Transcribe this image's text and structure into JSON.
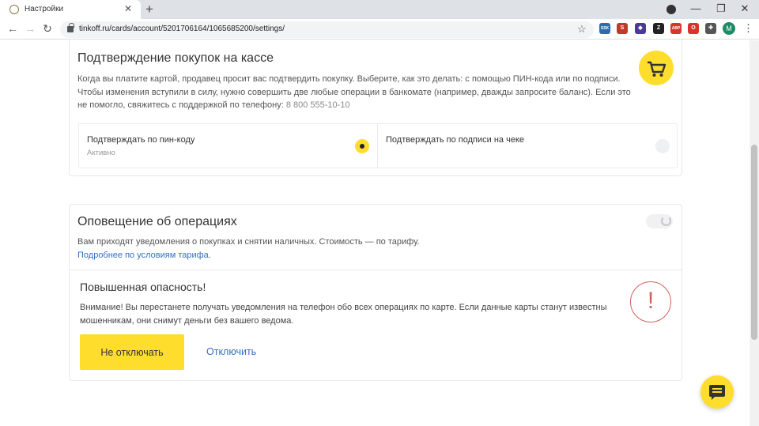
{
  "browser": {
    "tab_title": "Настройки",
    "tab_close": "✕",
    "new_tab": "+",
    "url": "tinkoff.ru/cards/account/5201706164/1065685200/settings/",
    "avatar_letter": "M",
    "window_controls": [
      "—",
      "❐",
      "✕"
    ],
    "extensions": [
      {
        "name": "ssk-extension",
        "label": "SSK",
        "color": "#2b6cb0"
      },
      {
        "name": "red-s-extension",
        "label": "S",
        "color": "#c0392b"
      },
      {
        "name": "purple-extension",
        "label": "◆",
        "color": "#4b3a9b"
      },
      {
        "name": "z-extension",
        "label": "Z",
        "color": "#222222"
      },
      {
        "name": "abp-extension",
        "label": "ABP",
        "color": "#d9342b"
      },
      {
        "name": "opera-extension",
        "label": "O",
        "color": "#d9342b"
      },
      {
        "name": "puzzle-extension",
        "label": "✚",
        "color": "#555555"
      }
    ]
  },
  "purchase_confirm": {
    "title": "Подтверждение покупок на кассе",
    "description_lines": [
      "Когда вы платите картой, продавец просит вас подтвердить покупку. Выберите, как это делать: с помощью ПИН-кода или по подписи.",
      "Чтобы изменения вступили в силу, нужно совершить две любые операции в банкомате (например, дважды запросите баланс). Если это",
      "не помогло, свяжитесь с поддержкой по телефону:"
    ],
    "phone": "8 800 555-10-10",
    "options": [
      {
        "label": "Подтверждать по пин-коду",
        "status": "Активно",
        "selected": true
      },
      {
        "label": "Подтверждать по подписи на чеке",
        "status": "",
        "selected": false
      }
    ]
  },
  "notifications": {
    "title": "Оповещение об операциях",
    "description": "Вам приходят уведомления о покупках и снятии наличных. Стоимость — по тарифу.",
    "tariff_link": "Подробнее по условиям тарифа.",
    "warning": {
      "title": "Повышенная опасность!",
      "lines": [
        "Внимание! Вы перестанете получать уведомления на телефон обо всех операциях по карте. Если данные карты станут известны",
        "мошенникам, они снимут деньги без вашего ведома."
      ],
      "icon_symbol": "!",
      "keep_button": "Не отключать",
      "disable_link": "Отключить"
    }
  },
  "colors": {
    "accent": "#ffdd2d",
    "link": "#336fbf",
    "danger": "#d5605a"
  }
}
